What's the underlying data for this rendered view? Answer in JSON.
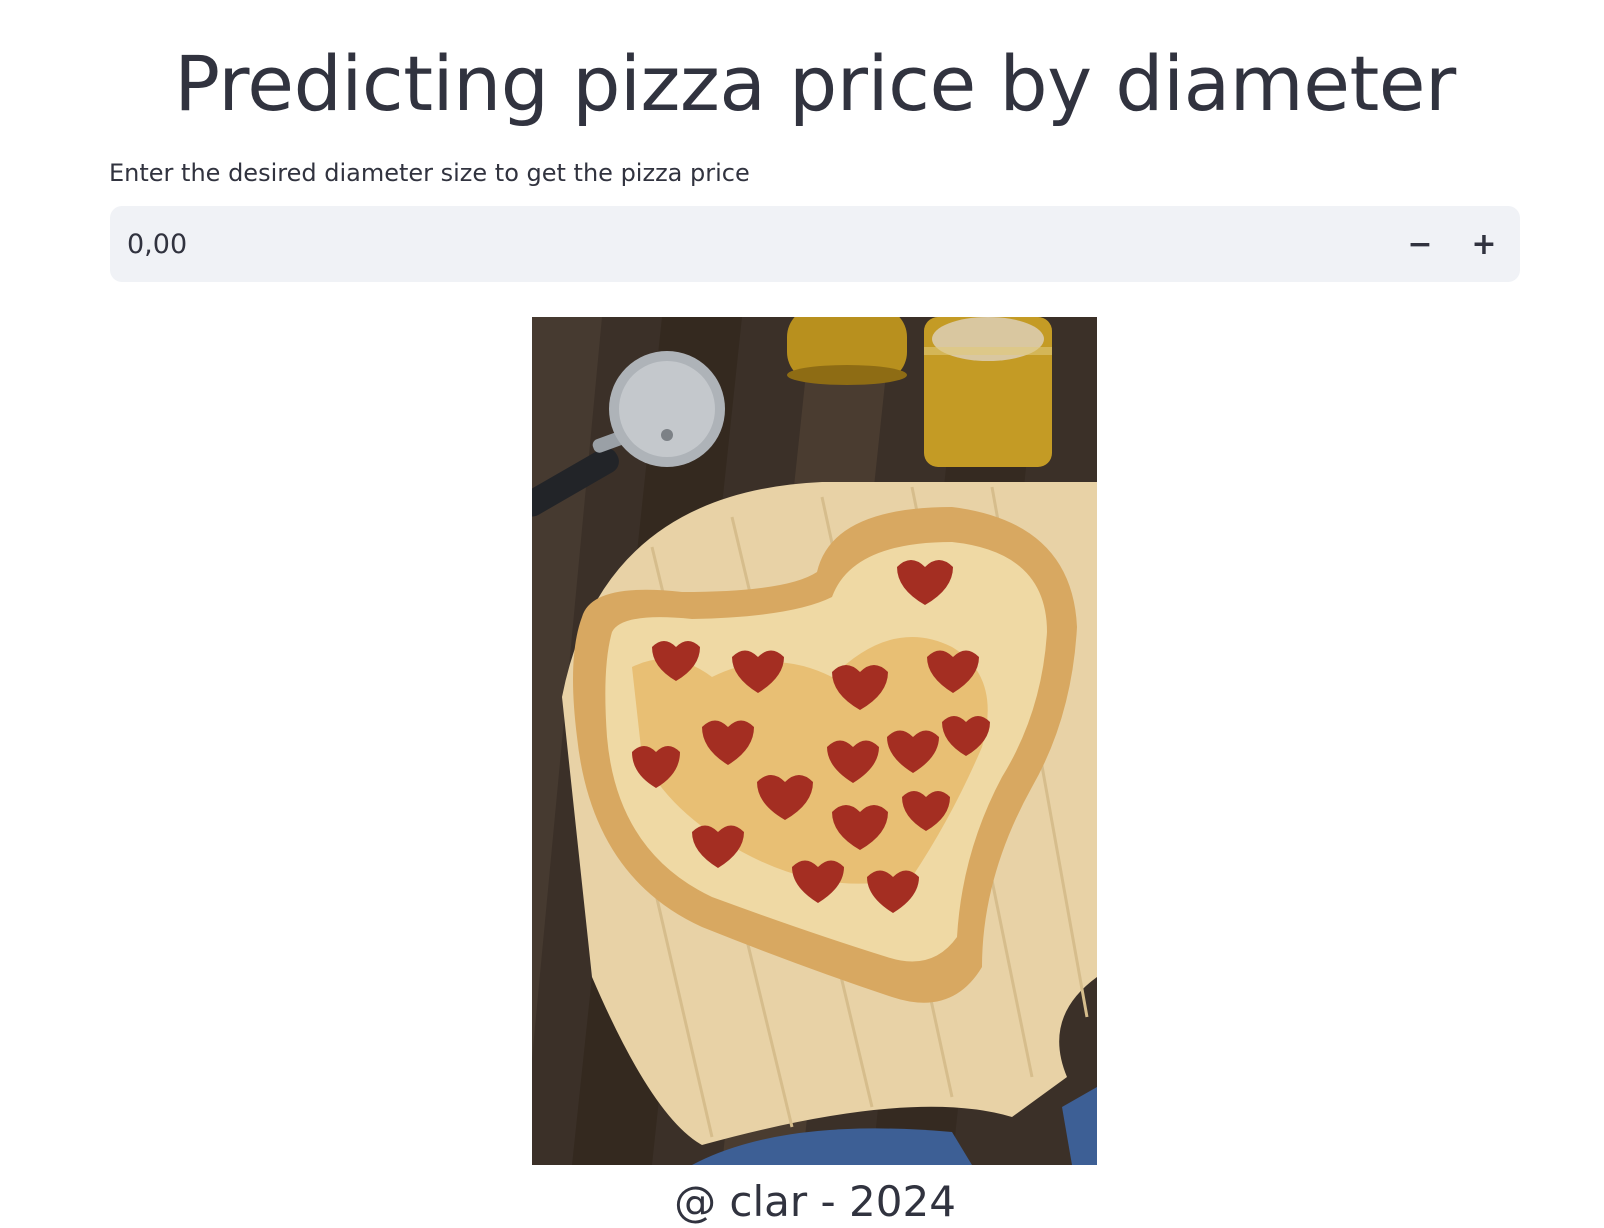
{
  "page": {
    "title": "Predicting pizza price by diameter"
  },
  "diameter_input": {
    "label": "Enter the desired diameter size to get the pizza price",
    "value": "0,00",
    "decrement_label": "−",
    "increment_label": "+"
  },
  "image": {
    "caption": "@ clar - 2024"
  },
  "colors": {
    "input_background": "#f0f2f6",
    "text": "#31333f"
  }
}
